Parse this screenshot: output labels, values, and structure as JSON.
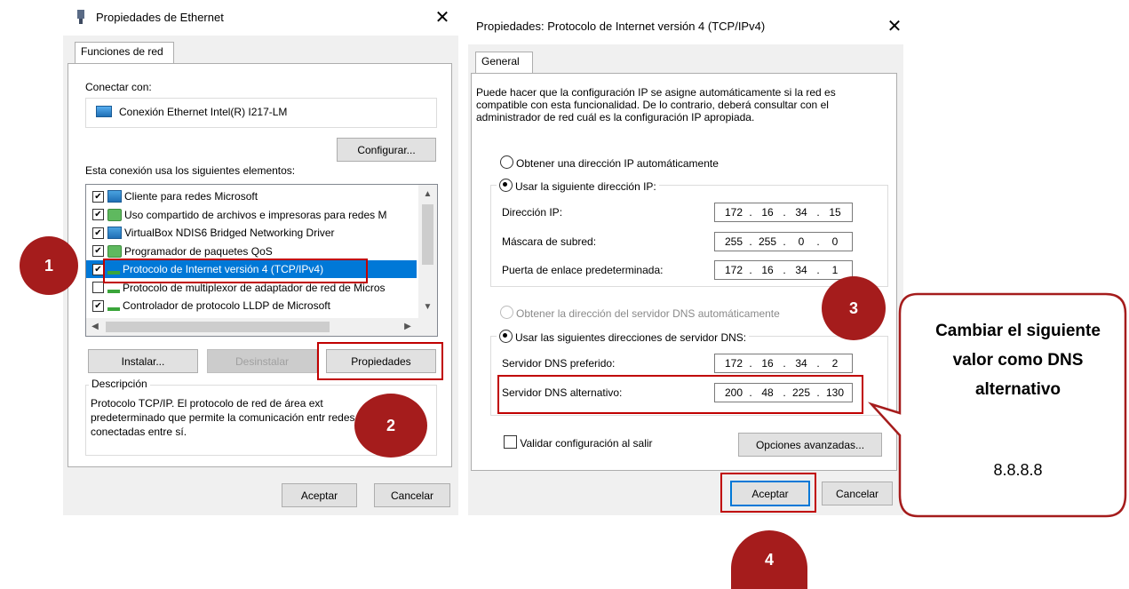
{
  "eth": {
    "title": "Propiedades de Ethernet",
    "tab": "Funciones de red",
    "connect_with": "Conectar con:",
    "adapter": "Conexión Ethernet Intel(R) I217-LM",
    "configure": "Configurar...",
    "elements_label": "Esta conexión usa los siguientes elementos:",
    "items": [
      {
        "label": "Cliente para redes Microsoft",
        "checked": true,
        "icon": "network-icon"
      },
      {
        "label": "Uso compartido de archivos e impresoras para redes M",
        "checked": true,
        "icon": "share-icon"
      },
      {
        "label": "VirtualBox NDIS6 Bridged Networking Driver",
        "checked": true,
        "icon": "network-icon"
      },
      {
        "label": "Programador de paquetes QoS",
        "checked": true,
        "icon": "share-icon"
      },
      {
        "label": "Protocolo de Internet versión 4 (TCP/IPv4)",
        "checked": true,
        "icon": "protocol-icon"
      },
      {
        "label": "Protocolo de multiplexor de adaptador de red de Micros",
        "checked": false,
        "icon": "protocol-icon"
      },
      {
        "label": "Controlador de protocolo LLDP de Microsoft",
        "checked": true,
        "icon": "protocol-icon"
      }
    ],
    "install": "Instalar...",
    "uninstall": "Desinstalar",
    "properties": "Propiedades",
    "description_label": "Descripción",
    "description": "Protocolo TCP/IP. El protocolo de red de área ext predeterminado que permite la comunicación entr redes conectadas entre sí.",
    "ok": "Aceptar",
    "cancel": "Cancelar"
  },
  "ipv4": {
    "title": "Propiedades: Protocolo de Internet versión 4 (TCP/IPv4)",
    "tab": "General",
    "intro": "Puede hacer que la configuración IP se asigne automáticamente si la red es compatible con esta funcionalidad. De lo contrario, deberá consultar con el administrador de red cuál es la configuración IP apropiada.",
    "auto_ip": "Obtener una dirección IP automáticamente",
    "manual_ip": "Usar la siguiente dirección IP:",
    "ip_label": "Dirección IP:",
    "ip_value": [
      "172",
      "16",
      "34",
      "15"
    ],
    "mask_label": "Máscara de subred:",
    "mask_value": [
      "255",
      "255",
      "0",
      "0"
    ],
    "gw_label": "Puerta de enlace predeterminada:",
    "gw_value": [
      "172",
      "16",
      "34",
      "1"
    ],
    "auto_dns": "Obtener la dirección del servidor DNS automáticamente",
    "manual_dns": "Usar las siguientes direcciones de servidor DNS:",
    "dns1_label": "Servidor DNS preferido:",
    "dns1_value": [
      "172",
      "16",
      "34",
      "2"
    ],
    "dns2_label": "Servidor DNS alternativo:",
    "dns2_value": [
      "200",
      "48",
      "225",
      "130"
    ],
    "validate": "Validar configuración al salir",
    "advanced": "Opciones avanzadas...",
    "ok": "Aceptar",
    "cancel": "Cancelar"
  },
  "callout": {
    "heading": "Cambiar el siguiente valor como DNS alternativo",
    "value": "8.8.8.8"
  },
  "badges": [
    "1",
    "2",
    "3",
    "4"
  ],
  "colors": {
    "accent_red": "#a51c1c",
    "highlight_blue": "#0078d7"
  }
}
